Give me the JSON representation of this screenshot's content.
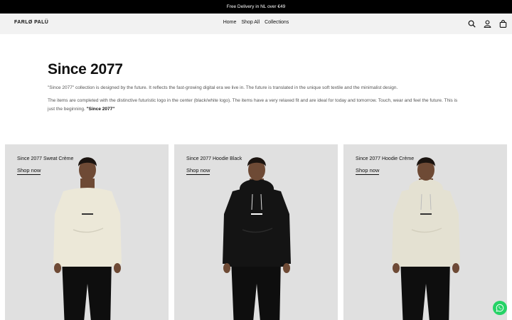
{
  "announcement": "Free Delivery in NL over €49",
  "header": {
    "logo": "FARLØ PALÜ",
    "nav": [
      "Home",
      "Shop All",
      "Collections"
    ],
    "icons": [
      "search-icon",
      "account-icon",
      "bag-icon"
    ]
  },
  "intro": {
    "title": "Since 2077",
    "p1": "\"Since 2077\" collection is designed by the future. It reflects the fast-growing digital era we live in. The future is translated in the unique soft textile and the minimalist design.",
    "p2": "The items are completed with the distinctive futuristic logo in the center (black/white logo). The items have a very relaxed fit and are ideal for today and tomorrow. Touch, wear and feel the future. This is just the beginning.",
    "p2_bold": "\"Since 2077\""
  },
  "cards": [
    {
      "title": "Since 2077 Sweat Crème",
      "link": "Shop now",
      "garment_color": "#ece8d8",
      "hood": false
    },
    {
      "title": "Since 2077 Hoodie Black",
      "link": "Shop now",
      "garment_color": "#141414",
      "hood": true
    },
    {
      "title": "Since 2077 Hoodie Crème",
      "link": "Shop now",
      "garment_color": "#e4e1d2",
      "hood": true
    }
  ],
  "chat": {
    "icon": "whatsapp-icon"
  }
}
